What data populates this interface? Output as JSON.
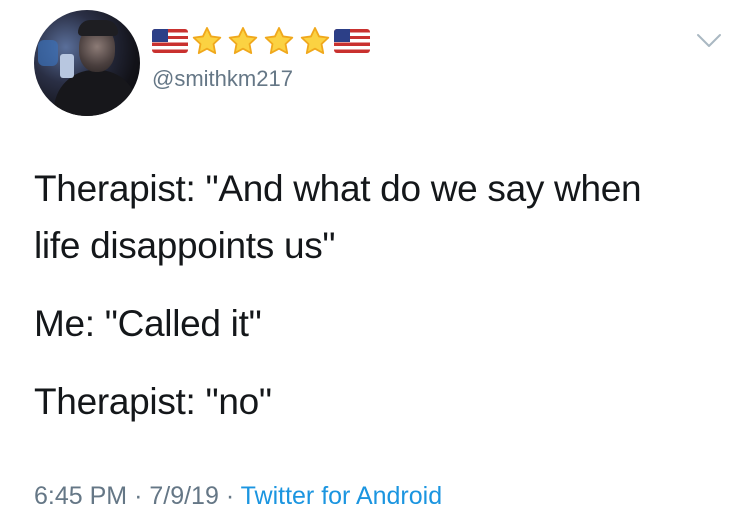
{
  "tweet": {
    "display_name_icons": [
      "us-flag-icon",
      "star-icon",
      "star-icon",
      "star-icon",
      "star-icon",
      "us-flag-icon"
    ],
    "handle": "@smithkm217",
    "lines": [
      "Therapist: \"And what do we say when",
      "life disappoints us\"",
      "Me: \"Called it\"",
      "Therapist: \"no\""
    ],
    "time": "6:45 PM",
    "separator": "·",
    "date": "7/9/19",
    "source": "Twitter for Android"
  },
  "colors": {
    "text": "#14171a",
    "secondary": "#657786",
    "link": "#1b95e0",
    "star_fill": "#fbd242",
    "star_stroke": "#f0a81c"
  }
}
